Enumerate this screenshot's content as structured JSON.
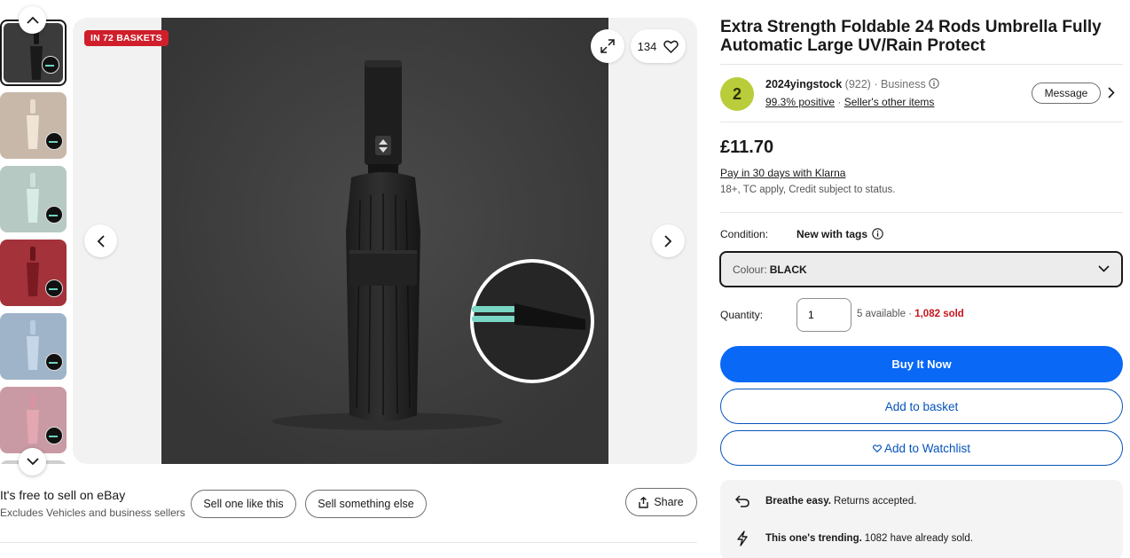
{
  "gallery": {
    "thumbnails": [
      {
        "name": "black",
        "bg": "#3b3b3b",
        "umbrella": "#1a1a1a",
        "selected": true
      },
      {
        "name": "beige",
        "bg": "#c8b8aa",
        "umbrella": "#efe4d6",
        "selected": false
      },
      {
        "name": "mint",
        "bg": "#b6c9c2",
        "umbrella": "#d6ece4",
        "selected": false
      },
      {
        "name": "red",
        "bg": "#a3323a",
        "umbrella": "#7a1b22",
        "selected": false
      },
      {
        "name": "blue",
        "bg": "#9fb4c8",
        "umbrella": "#c4d6e8",
        "selected": false
      },
      {
        "name": "pink",
        "bg": "#c99aa3",
        "umbrella": "#e3a7b2",
        "selected": false
      }
    ],
    "badge": "IN 72 BASKETS",
    "watch_count": "134"
  },
  "sell": {
    "title": "It's free to sell on eBay",
    "subtitle": "Excludes Vehicles and business sellers",
    "sell_one_label": "Sell one like this",
    "sell_else_label": "Sell something else",
    "share_label": "Share"
  },
  "product": {
    "title": "Extra Strength Foldable 24 Rods Umbrella Fully Automatic Large UV/Rain Protect",
    "price": "£11.70",
    "klarna": "Pay in 30 days with Klarna",
    "klarna_note": "18+, TC apply, Credit subject to status."
  },
  "seller": {
    "avatar_letter": "2",
    "name": "2024yingstock",
    "feedback_count": "(922)",
    "type": "Business",
    "positive": "99.3% positive",
    "other_items": "Seller's other items",
    "message_label": "Message"
  },
  "condition": {
    "label": "Condition:",
    "value": "New with tags"
  },
  "colour": {
    "label": "Colour:",
    "value": "BLACK"
  },
  "quantity": {
    "label": "Quantity:",
    "value": "1",
    "available": "5 available",
    "sold": "1,082 sold"
  },
  "actions": {
    "buy_now": "Buy It Now",
    "add_basket": "Add to basket",
    "add_watchlist": "Add to Watchlist"
  },
  "promos": [
    {
      "icon": "return-arrow-icon",
      "bold": "Breathe easy.",
      "text": "Returns accepted."
    },
    {
      "icon": "lightning-icon",
      "bold": "This one's trending.",
      "text": "1082 have already sold."
    }
  ],
  "colors": {
    "buy_blue": "#0968f6",
    "link_blue": "#0654ba",
    "badge_red": "#d01f2b",
    "sold_red": "#c5161d",
    "avatar_green": "#b9cc3a"
  }
}
